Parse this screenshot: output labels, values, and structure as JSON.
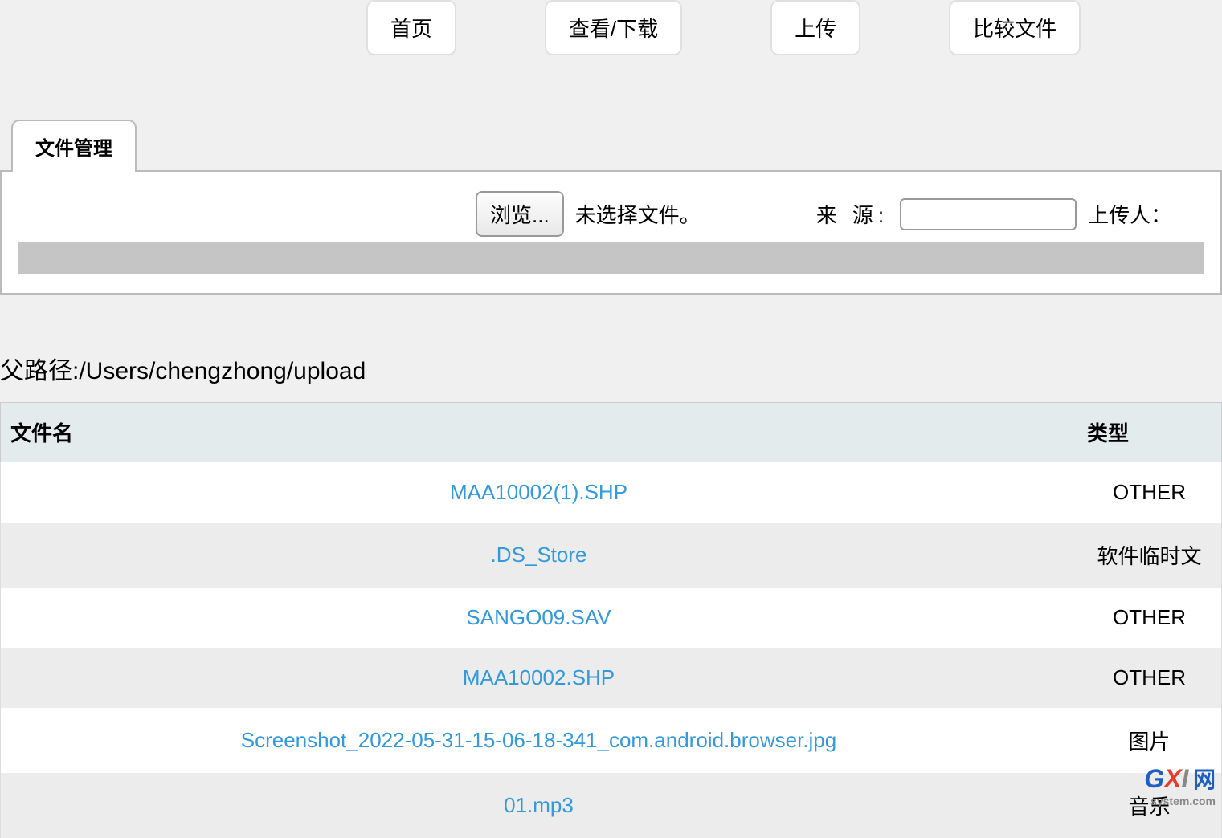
{
  "nav": {
    "home": "首页",
    "view_download": "查看/下载",
    "upload": "上传",
    "compare": "比较文件"
  },
  "tab": {
    "file_management": "文件管理"
  },
  "upload_form": {
    "browse_label": "浏览...",
    "no_file_text": "未选择文件。",
    "source_label": "来 源:",
    "uploader_label": "上传人："
  },
  "path": {
    "label_prefix": "父路径:",
    "value": "/Users/chengzhong/upload"
  },
  "table": {
    "headers": {
      "filename": "文件名",
      "type": "类型"
    },
    "rows": [
      {
        "name": "MAA10002(1).SHP",
        "type": "OTHER"
      },
      {
        "name": ".DS_Store",
        "type": "软件临时文"
      },
      {
        "name": "SANGO09.SAV",
        "type": "OTHER"
      },
      {
        "name": "MAA10002.SHP",
        "type": "OTHER"
      },
      {
        "name": "Screenshot_2022-05-31-15-06-18-341_com.android.browser.jpg",
        "type": "图片"
      },
      {
        "name": "01.mp3",
        "type": "音乐"
      }
    ]
  },
  "watermark": {
    "g": "G",
    "x": "X",
    "i": "I",
    "net": "网",
    "sub": "system.com"
  }
}
